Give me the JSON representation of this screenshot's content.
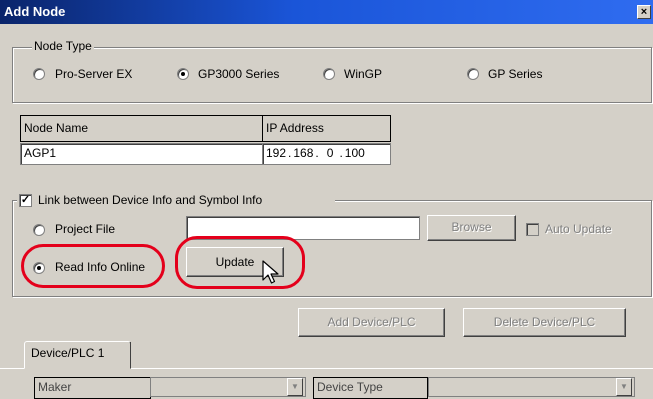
{
  "window": {
    "title": "Add Node",
    "close_symbol": "×"
  },
  "node_type": {
    "legend": "Node Type",
    "options": [
      {
        "label": "Pro-Server EX",
        "checked": false
      },
      {
        "label": "GP3000 Series",
        "checked": true
      },
      {
        "label": "WinGP",
        "checked": false
      },
      {
        "label": "GP Series",
        "checked": false
      }
    ]
  },
  "node": {
    "name_header": "Node Name",
    "name_value": "AGP1",
    "ip_header": "IP Address",
    "ip_octets": [
      "192",
      "168",
      "0",
      "100"
    ]
  },
  "link": {
    "checkbox_label": "Link between Device Info and Symbol Info",
    "checkbox_mark": "✓",
    "project_file_label": "Project File",
    "project_file_value": "",
    "browse_label": "Browse",
    "auto_update_label": "Auto Update",
    "read_online_label": "Read Info Online",
    "update_label": "Update"
  },
  "device_buttons": {
    "add_label": "Add Device/PLC",
    "delete_label": "Delete Device/PLC"
  },
  "tab": {
    "label": "Device/PLC 1"
  },
  "device_fields": {
    "maker_label": "Maker",
    "device_type_label": "Device Type"
  },
  "colors": {
    "title_bar": "#0a246a",
    "highlight": "#e4001b",
    "dialog_bg": "#d4d0c8"
  }
}
